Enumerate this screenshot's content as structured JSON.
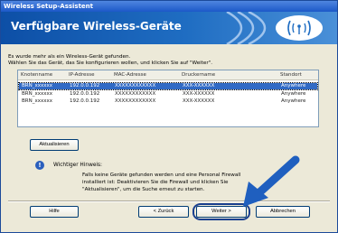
{
  "window": {
    "title": "Wireless Setup-Assistent"
  },
  "banner": {
    "heading": "Verfügbare Wireless-Geräte"
  },
  "intro": {
    "line1": "Es wurde mehr als ein Wireless-Gerät gefunden.",
    "line2": "Wählen Sie das Gerät, das Sie konfigurieren wollen, und klicken Sie auf \"Weiter\"."
  },
  "device_list": {
    "columns": [
      "Knotenname",
      "IP-Adresse",
      "MAC-Adresse",
      "Druckername",
      "Standort"
    ],
    "rows": [
      {
        "node": "BRN_xxxxxx",
        "ip": "192.0.0.192",
        "mac": "XXXXXXXXXXXX",
        "printer": "XXX-XXXXXX",
        "location": "Anywhere",
        "selected": true
      },
      {
        "node": "BRN_xxxxxx",
        "ip": "192.0.0.192",
        "mac": "XXXXXXXXXXXX",
        "printer": "XXX-XXXXXX",
        "location": "Anywhere",
        "selected": false
      },
      {
        "node": "BRN_xxxxxx",
        "ip": "192.0.0.192",
        "mac": "XXXXXXXXXXXX",
        "printer": "XXX-XXXXXX",
        "location": "Anywhere",
        "selected": false
      }
    ]
  },
  "buttons": {
    "refresh": "Aktualisieren",
    "help": "Hilfe",
    "back": "< Zurück",
    "next": "Weiter >",
    "cancel": "Abbrechen"
  },
  "hint": {
    "title": "Wichtiger Hinweis:",
    "line1": "Falls keine Geräte gefunden werden und eine Personal Firewall",
    "line2": "installiert ist: Deaktivieren Sie die Firewall und klicken Sie",
    "line3": "\"Aktualisieren\", um die Suche erneut zu starten."
  },
  "icons": {
    "info": "info-icon",
    "wireless": "wireless-icon",
    "arrow": "pointer-arrow"
  },
  "colors": {
    "banner": "#1f6dc2",
    "selection": "#316ac5",
    "arrow": "#1f5fbf"
  }
}
